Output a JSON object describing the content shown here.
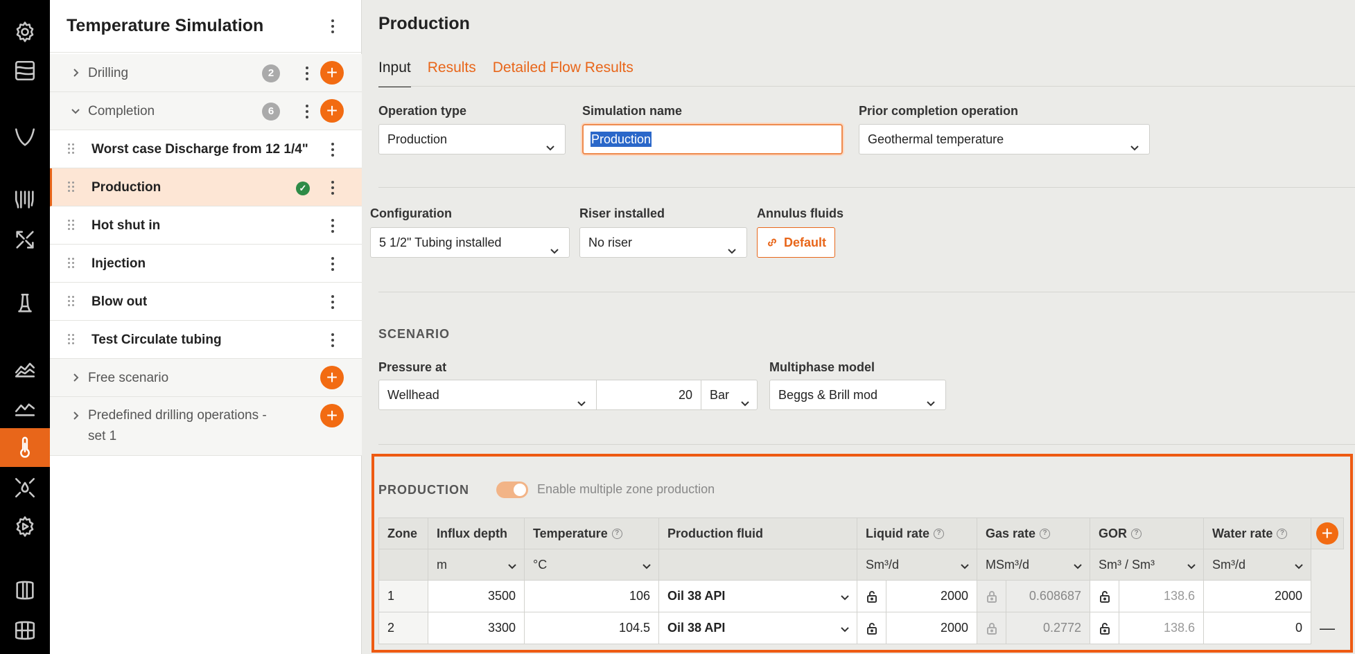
{
  "app": {
    "accent": "#e8661a"
  },
  "rail": {
    "icons": [
      "gear-icon",
      "layers-icon",
      "curve-icon",
      "drill-strings-icon",
      "merge-arrows-icon",
      "rig-icon",
      "area-chart-icon",
      "line-chart-icon",
      "thermometer-icon",
      "drops-icon",
      "gear-play-icon",
      "database-icon",
      "cylinders-icon"
    ]
  },
  "tree": {
    "title": "Temperature Simulation",
    "groups": [
      {
        "label": "Drilling",
        "count": "2"
      },
      {
        "label": "Completion",
        "count": "6"
      }
    ],
    "children": [
      {
        "label": "Worst case Discharge from 12 1/4\""
      },
      {
        "label": "Production"
      },
      {
        "label": "Hot shut in"
      },
      {
        "label": "Injection"
      },
      {
        "label": "Blow out"
      },
      {
        "label": "Test Circulate tubing"
      }
    ],
    "extra_groups": [
      {
        "label": "Free scenario"
      },
      {
        "label": "Predefined drilling operations -",
        "label2": "set 1"
      }
    ]
  },
  "main": {
    "title": "Production",
    "tabs": [
      "Input",
      "Results",
      "Detailed Flow Results"
    ],
    "operation_type": {
      "label": "Operation type",
      "value": "Production"
    },
    "simulation_name": {
      "label": "Simulation name",
      "value": "Production"
    },
    "prior_completion": {
      "label": "Prior completion operation",
      "value": "Geothermal temperature"
    },
    "configuration": {
      "label": "Configuration",
      "value": "5 1/2\" Tubing installed"
    },
    "riser": {
      "label": "Riser installed",
      "value": "No riser"
    },
    "annulus": {
      "label": "Annulus fluids",
      "button": "Default"
    },
    "scenario": {
      "title": "SCENARIO",
      "pressure_at_label": "Pressure at",
      "pressure_at": "Wellhead",
      "pressure_value": "20",
      "pressure_unit": "Bar",
      "multiphase_label": "Multiphase model",
      "multiphase": "Beggs & Brill mod"
    },
    "production": {
      "title": "PRODUCTION",
      "toggle_label": "Enable multiple zone production",
      "toggle_on": true,
      "headers": [
        "Zone",
        "Influx depth",
        "Temperature",
        "Production fluid",
        "Liquid rate",
        "Gas rate",
        "GOR",
        "Water rate"
      ],
      "units": [
        "m",
        "°C",
        "Sm³/d",
        "MSm³/d",
        "Sm³ / Sm³",
        "Sm³/d"
      ],
      "rows": [
        {
          "zone": "1",
          "depth": "3500",
          "temp": "106",
          "fluid": "Oil 38 API",
          "liquid": "2000",
          "gas": "0.608687",
          "gor": "138.6",
          "water": "2000"
        },
        {
          "zone": "2",
          "depth": "3300",
          "temp": "104.5",
          "fluid": "Oil 38 API",
          "liquid": "2000",
          "gas": "0.2772",
          "gor": "138.6",
          "water": "0"
        }
      ],
      "remove_symbol": "—"
    }
  }
}
